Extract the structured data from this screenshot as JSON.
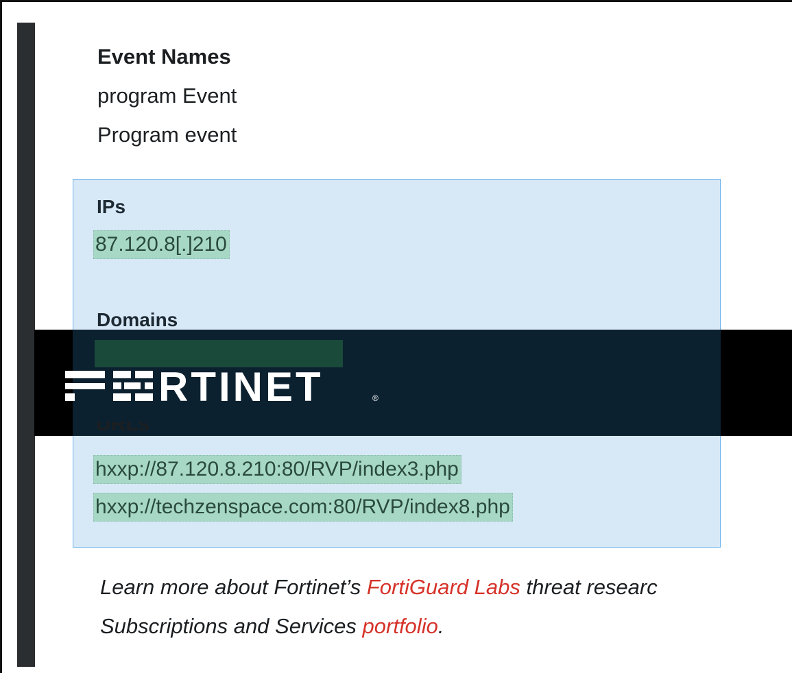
{
  "event_names": {
    "heading": "Event Names",
    "items": [
      "program Event",
      "Program event"
    ]
  },
  "ips": {
    "heading": "IPs",
    "items": [
      "87.120.8[.]210"
    ]
  },
  "domains": {
    "heading": "Domains"
  },
  "urls": {
    "heading": "URLs",
    "items": [
      "hxxp://87.120.8.210:80/RVP/index3.php",
      "hxxp://techzenspace.com:80/RVP/index8.php"
    ]
  },
  "banner": {
    "logo_text": "FORTINET",
    "registered_mark": "®"
  },
  "footer": {
    "line1_prefix": "Learn more about Fortinet’s ",
    "line1_link": "FortiGuard Labs",
    "line1_suffix": " threat researc",
    "line2_prefix": "Subscriptions and Services ",
    "line2_link": "portfolio",
    "line2_suffix": "."
  },
  "colors": {
    "link": "#d6332a",
    "ioc_highlight": "#a7d8c6",
    "ioc_box_bg": "#d7e8f7",
    "banner_bg": "#000000"
  }
}
